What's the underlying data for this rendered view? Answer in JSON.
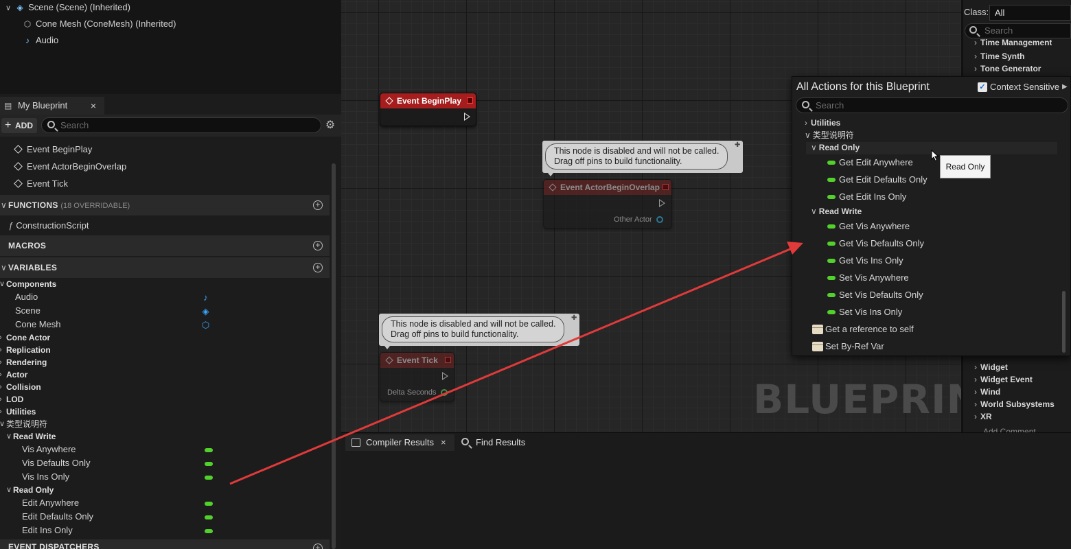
{
  "components": {
    "items": [
      {
        "label": "Scene (Scene) (Inherited)",
        "icon": "scene-icon"
      },
      {
        "label": "Cone Mesh (ConeMesh) (Inherited)",
        "icon": "mesh-icon"
      },
      {
        "label": "Audio",
        "icon": "audio-icon"
      }
    ]
  },
  "my_blueprint": {
    "tab_label": "My Blueprint",
    "add_label": "ADD",
    "search_placeholder": "Search",
    "events": [
      "Event BeginPlay",
      "Event ActorBeginOverlap",
      "Event Tick"
    ],
    "functions_header": "FUNCTIONS",
    "functions_sub": "(18 OVERRIDABLE)",
    "function_item": "ConstructionScript",
    "macros_header": "MACROS",
    "variables_header": "VARIABLES",
    "components_cat": "Components",
    "component_vars": [
      "Audio",
      "Scene",
      "Cone Mesh"
    ],
    "categories": [
      "Cone Actor",
      "Replication",
      "Rendering",
      "Actor",
      "Collision",
      "LOD",
      "Utilities"
    ],
    "custom_cat": "类型说明符",
    "read_write_cat": "Read Write",
    "read_write_vars": [
      "Vis Anywhere",
      "Vis Defaults Only",
      "Vis Ins Only"
    ],
    "read_only_cat": "Read Only",
    "read_only_vars": [
      "Edit Anywhere",
      "Edit Defaults Only",
      "Edit Ins Only"
    ],
    "dispatchers_header": "EVENT DISPATCHERS"
  },
  "graph": {
    "watermark": "BLUEPRINT",
    "nodes": {
      "begin_play": "Event BeginPlay",
      "begin_overlap": "Event ActorBeginOverlap",
      "begin_overlap_pin": "Other Actor",
      "tick": "Event Tick",
      "tick_pin": "Delta Seconds"
    },
    "disabled_line1": "This node is disabled and will not be called.",
    "disabled_line2": "Drag off pins to build functionality."
  },
  "palette": {
    "class_label": "Class:",
    "class_value": "All",
    "search_placeholder": "Search",
    "top_categories": [
      "Time Management",
      "Time Synth",
      "Tone Generator"
    ],
    "bottom_categories": [
      "Widget",
      "Widget Event",
      "Wind",
      "World Subsystems",
      "XR"
    ],
    "partial_item": "Add Comment..."
  },
  "action_menu": {
    "title": "All Actions for this Blueprint",
    "context_label": "Context Sensitive",
    "search_placeholder": "Search",
    "utilities": "Utilities",
    "custom_cat": "类型说明符",
    "read_only_cat": "Read Only",
    "read_only_items": [
      "Get Edit Anywhere",
      "Get Edit Defaults Only",
      "Get Edit Ins Only"
    ],
    "read_write_cat": "Read Write",
    "read_write_items": [
      "Get Vis Anywhere",
      "Get Vis Defaults Only",
      "Get Vis Ins Only",
      "Set Vis Anywhere",
      "Set Vis Defaults Only",
      "Set Vis Ins Only"
    ],
    "extra_items": [
      "Get a reference to self",
      "Set By-Ref Var"
    ],
    "tooltip": "Read Only"
  },
  "bottom": {
    "compiler_tab": "Compiler Results",
    "find_tab": "Find Results"
  },
  "colors": {
    "variable_pill": "#52d02b",
    "event_header": "#a51d1d",
    "annotation_arrow": "#e03a3a",
    "component_icon": "#3aa8ff"
  }
}
